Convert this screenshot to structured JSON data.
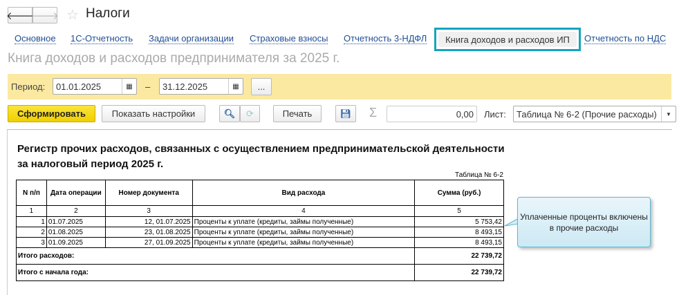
{
  "header": {
    "title": "Налоги"
  },
  "tabs": [
    {
      "label": "Основное"
    },
    {
      "label": "1С-Отчетность"
    },
    {
      "label": "Задачи организации"
    },
    {
      "label": "Страховые взносы"
    },
    {
      "label": "Отчетность 3-НДФЛ"
    },
    {
      "label": "Книга доходов и расходов ИП",
      "active": true
    },
    {
      "label": "Отчетность по НДС"
    }
  ],
  "subtitle": "Книга доходов и расходов предпринимателя за 2025 г.",
  "period": {
    "label": "Период:",
    "from": "01.01.2025",
    "dash": "–",
    "to": "31.12.2025",
    "more": "..."
  },
  "toolbar": {
    "generate": "Сформировать",
    "settings": "Показать настройки",
    "print": "Печать",
    "sum": "0,00",
    "sheet_label": "Лист:",
    "sheet_value": "Таблица № 6-2 (Прочие расходы)"
  },
  "report": {
    "title1": "Регистр прочих расходов, связанных с осуществлением предпринимательской деятельности",
    "title2": "за налоговый период 2025 г.",
    "table_no": "Таблица № 6-2",
    "headers": [
      "N п/п",
      "Дата операции",
      "Номер документа",
      "Вид расхода",
      "Сумма (руб.)"
    ],
    "col_numbers": [
      "1",
      "2",
      "3",
      "4",
      "5"
    ],
    "rows": [
      {
        "n": "1",
        "date": "01.07.2025",
        "doc": "12, 01.07.2025",
        "type": "Проценты к уплате (кредиты, займы полученные)",
        "sum": "5 753,42"
      },
      {
        "n": "2",
        "date": "01.08.2025",
        "doc": "23, 01.08.2025",
        "type": "Проценты к уплате (кредиты, займы полученные)",
        "sum": "8 493,15"
      },
      {
        "n": "3",
        "date": "01.09.2025",
        "doc": "27, 01.09.2025",
        "type": "Проценты к уплате (кредиты, займы полученные)",
        "sum": "8 493,15"
      }
    ],
    "total_label": "Итого расходов:",
    "total": "22 739,72",
    "ytd_label": "Итого с начала года:",
    "ytd": "22 739,72"
  },
  "callout": "Уплаченные проценты включены в прочие расходы",
  "colors": {
    "accent": "#14a3c0",
    "period_bg": "#fbe9a1",
    "generate_bg": "#f5d800"
  }
}
